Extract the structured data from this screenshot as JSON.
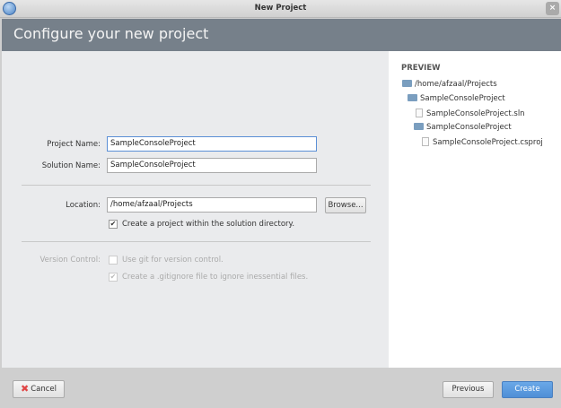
{
  "window": {
    "title": "New Project",
    "close": "×"
  },
  "header": {
    "title": "Configure your new project"
  },
  "form": {
    "project_name_label": "Project Name:",
    "project_name": "SampleConsoleProject",
    "solution_name_label": "Solution Name:",
    "solution_name": "SampleConsoleProject",
    "location_label": "Location:",
    "location": "/home/afzaal/Projects",
    "browse": "Browse...",
    "create_in_solution_dir": "Create a project within the solution directory.",
    "create_in_solution_dir_checked": true,
    "version_control_label": "Version Control:",
    "use_git": "Use git for version control.",
    "use_git_checked": false,
    "gitignore": "Create a .gitignore file to ignore inessential files.",
    "gitignore_checked": true
  },
  "preview": {
    "title": "PREVIEW",
    "items": [
      {
        "label": "/home/afzaal/Projects",
        "icon": "folder-icon"
      },
      {
        "label": "SampleConsoleProject",
        "icon": "folder-icon"
      },
      {
        "label": "SampleConsoleProject.sln",
        "icon": "file-icon"
      },
      {
        "label": "SampleConsoleProject",
        "icon": "folder-icon"
      },
      {
        "label": "SampleConsoleProject.csproj",
        "icon": "file-icon"
      }
    ]
  },
  "footer": {
    "cancel": "Cancel",
    "previous": "Previous",
    "create": "Create"
  },
  "colors": {
    "header": "#76808a",
    "accent": "#5b9be0"
  }
}
